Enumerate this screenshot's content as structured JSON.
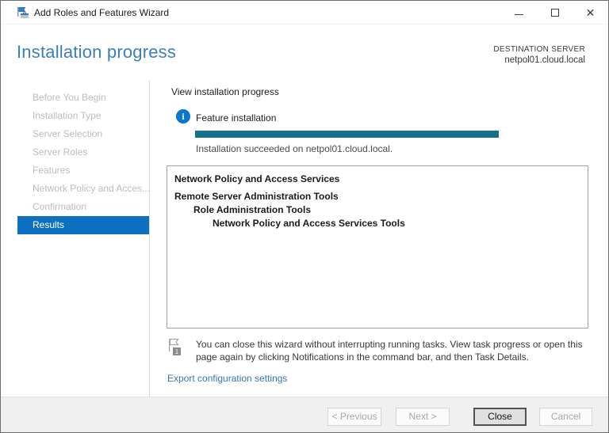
{
  "window": {
    "title": "Add Roles and Features Wizard"
  },
  "header": {
    "title": "Installation progress",
    "destination_label": "DESTINATION SERVER",
    "destination_server": "netpol01.cloud.local"
  },
  "sidebar": {
    "items": [
      {
        "label": "Before You Begin",
        "state": "disabled"
      },
      {
        "label": "Installation Type",
        "state": "disabled"
      },
      {
        "label": "Server Selection",
        "state": "disabled"
      },
      {
        "label": "Server Roles",
        "state": "disabled"
      },
      {
        "label": "Features",
        "state": "disabled"
      },
      {
        "label": "Network Policy and Acces...",
        "state": "disabled"
      },
      {
        "label": "Confirmation",
        "state": "disabled"
      },
      {
        "label": "Results",
        "state": "selected"
      }
    ]
  },
  "main": {
    "section_label": "View installation progress",
    "feature_installation": {
      "icon": "info-icon",
      "icon_glyph": "i",
      "title": "Feature installation",
      "progress_percent": 100,
      "status": "Installation succeeded on netpol01.cloud.local."
    },
    "installed_items": [
      {
        "label": "Network Policy and Access Services",
        "indent": 0
      },
      {
        "label": "Remote Server Administration Tools",
        "indent": 0
      },
      {
        "label": "Role Administration Tools",
        "indent": 1
      },
      {
        "label": "Network Policy and Access Services Tools",
        "indent": 2
      }
    ],
    "note": {
      "badge_count": "1",
      "text": "You can close this wizard without interrupting running tasks. View task progress or open this page again by clicking Notifications in the command bar, and then Task Details."
    },
    "export_link": "Export configuration settings"
  },
  "footer": {
    "buttons": [
      {
        "label": "< Previous",
        "state": "disabled"
      },
      {
        "label": "Next >",
        "state": "disabled"
      },
      {
        "label": "Close",
        "state": "default-focused"
      },
      {
        "label": "Cancel",
        "state": "disabled"
      }
    ]
  },
  "colors": {
    "heading_blue": "#3a7ebd",
    "selected_nav_blue": "#0e70c1",
    "progress_teal": "#17718d",
    "info_icon_blue": "#0b76d0",
    "link_blue": "#3575b8",
    "footer_gray": "#f0f0f0"
  }
}
